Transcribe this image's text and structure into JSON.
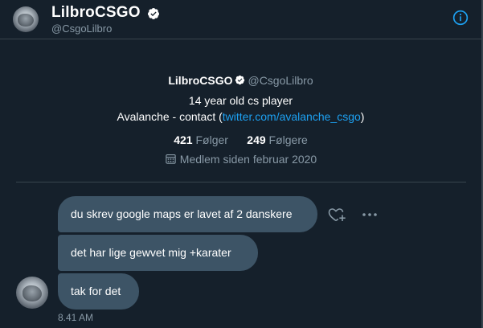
{
  "header": {
    "display_name": "LilbroCSGO",
    "handle": "@CsgoLilbro",
    "verified_icon": "verified-badge-icon",
    "info_icon": "info-icon"
  },
  "profile": {
    "display_name": "LilbroCSGO",
    "handle": "@CsgoLilbro",
    "bio_line1": "14 year old cs player",
    "bio_line2_prefix": "Avalanche - contact (",
    "bio_link": "twitter.com/avalanche_csgo",
    "bio_line2_suffix": ")",
    "following_count": "421",
    "following_label": "Følger",
    "followers_count": "249",
    "followers_label": "Følgere",
    "joined": "Medlem siden februar 2020",
    "calendar_icon": "calendar-icon"
  },
  "messages": [
    {
      "text": "du skrev google maps er lavet af 2 danskere"
    },
    {
      "text": "det har lige gewvet mig +karater"
    },
    {
      "text": "tak for det"
    }
  ],
  "message_actions": {
    "react_icon": "heart-plus-icon",
    "more_icon": "more-horizontal-icon"
  },
  "timestamp": "8.41 AM",
  "colors": {
    "background": "#15202b",
    "bubble": "#3d5466",
    "accent": "#1da1f2",
    "muted_text": "#8899a6",
    "border": "#38444d"
  }
}
